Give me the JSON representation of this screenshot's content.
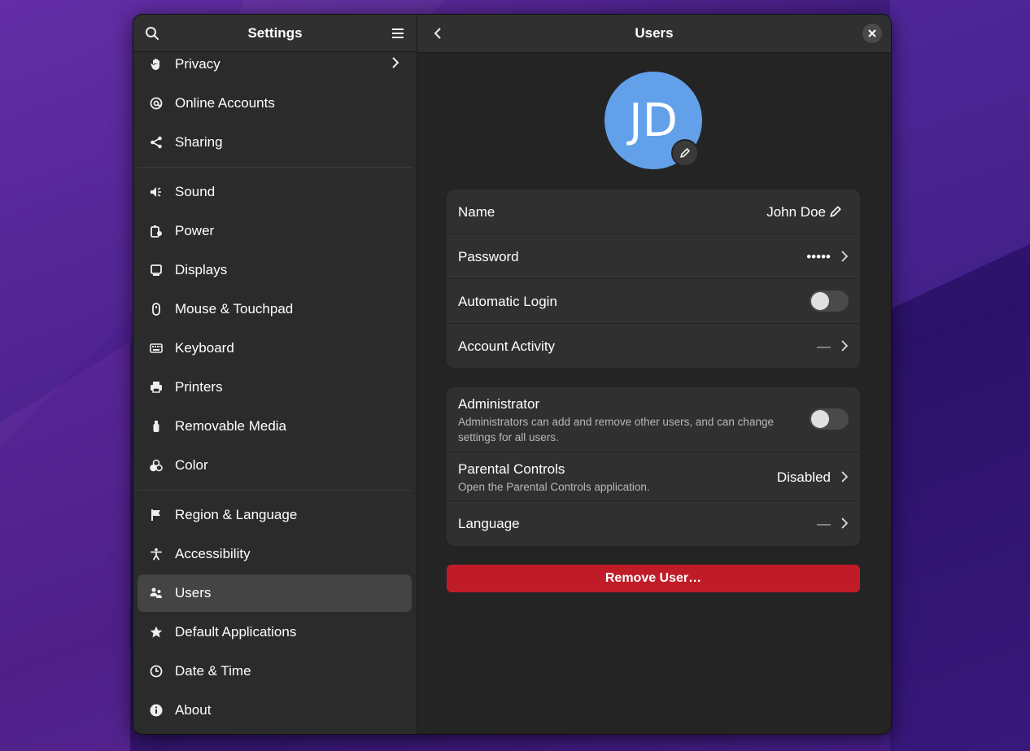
{
  "sidebar": {
    "title": "Settings",
    "items": [
      {
        "label": "Privacy",
        "icon": "hand-icon"
      },
      {
        "label": "Online Accounts",
        "icon": "at-icon"
      },
      {
        "label": "Sharing",
        "icon": "share-icon"
      },
      {
        "label": "Sound",
        "icon": "speaker-icon"
      },
      {
        "label": "Power",
        "icon": "power-icon"
      },
      {
        "label": "Displays",
        "icon": "display-icon"
      },
      {
        "label": "Mouse & Touchpad",
        "icon": "mouse-icon"
      },
      {
        "label": "Keyboard",
        "icon": "keyboard-icon"
      },
      {
        "label": "Printers",
        "icon": "printer-icon"
      },
      {
        "label": "Removable Media",
        "icon": "usb-icon"
      },
      {
        "label": "Color",
        "icon": "color-icon"
      },
      {
        "label": "Region & Language",
        "icon": "flag-icon"
      },
      {
        "label": "Accessibility",
        "icon": "accessibility-icon"
      },
      {
        "label": "Users",
        "icon": "users-icon"
      },
      {
        "label": "Default Applications",
        "icon": "star-icon"
      },
      {
        "label": "Date & Time",
        "icon": "clock-icon"
      },
      {
        "label": "About",
        "icon": "info-icon"
      }
    ],
    "active": "Users"
  },
  "header": {
    "title": "Users"
  },
  "user": {
    "initials": "JD"
  },
  "account": {
    "name_label": "Name",
    "name_value": "John Doe",
    "password_label": "Password",
    "password_value": "•••••",
    "autologin_label": "Automatic Login",
    "autologin_on": false,
    "activity_label": "Account Activity",
    "activity_value": "—"
  },
  "permissions": {
    "admin_label": "Administrator",
    "admin_desc": "Administrators can add and remove other users, and can change settings for all users.",
    "admin_on": false,
    "parental_label": "Parental Controls",
    "parental_desc": "Open the Parental Controls application.",
    "parental_value": "Disabled",
    "language_label": "Language",
    "language_value": "—"
  },
  "remove_button": "Remove User…",
  "colors": {
    "accent": "#62a0ea",
    "destructive": "#c01c28"
  }
}
